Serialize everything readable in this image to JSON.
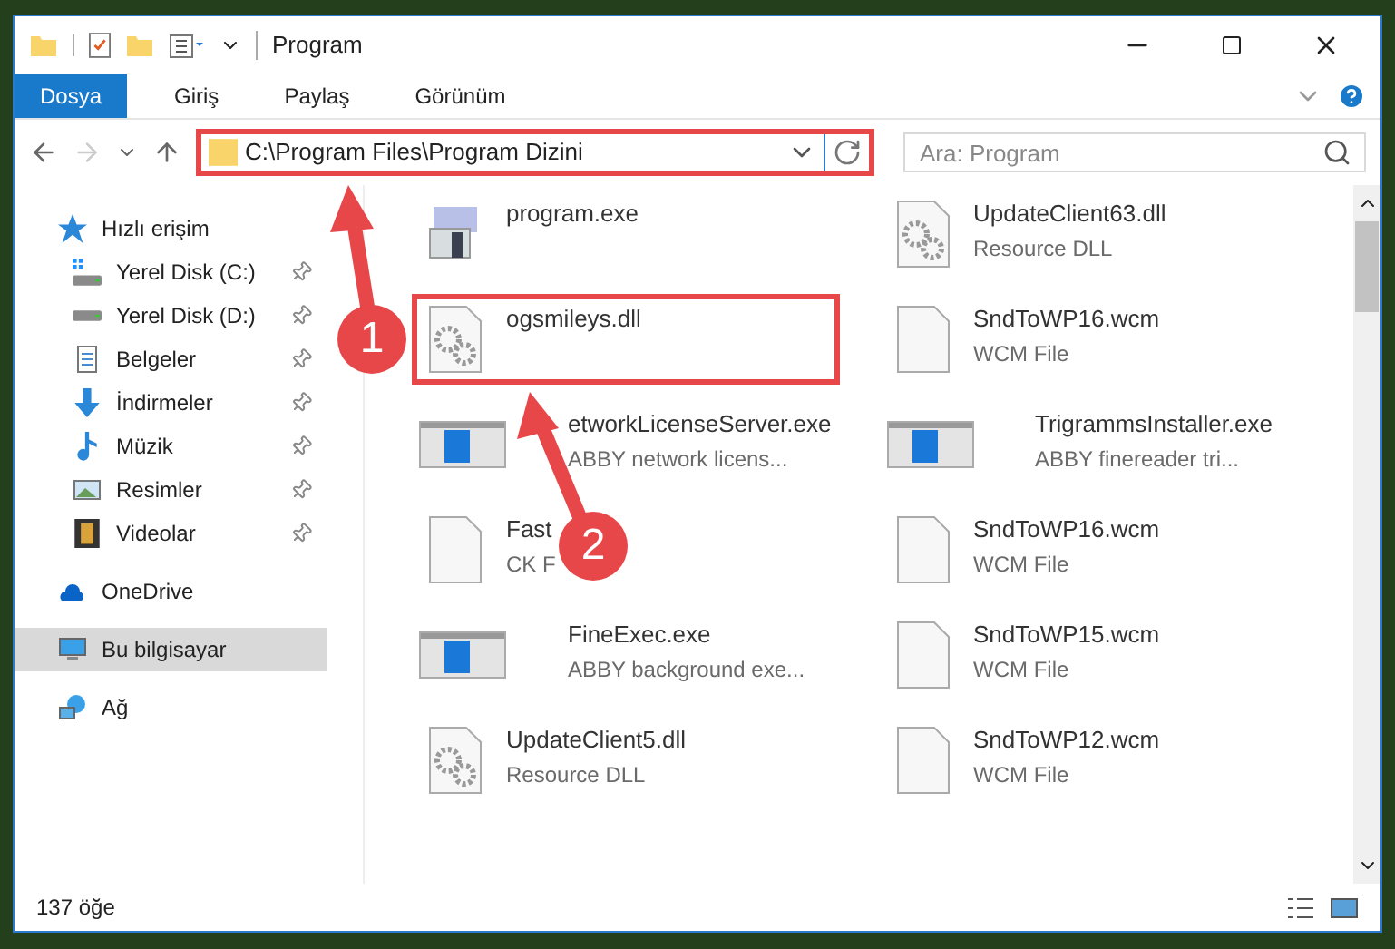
{
  "window": {
    "title": "Program"
  },
  "ribbon_tabs": [
    {
      "label": "Dosya",
      "selected": true
    },
    {
      "label": "Giriş",
      "selected": false
    },
    {
      "label": "Paylaş",
      "selected": false
    },
    {
      "label": "Görünüm",
      "selected": false
    }
  ],
  "address_bar": {
    "value": "C:\\Program Files\\Program Dizini",
    "highlighted": true
  },
  "search": {
    "placeholder": "Ara: Program"
  },
  "sidebar": {
    "items": [
      {
        "label": "Hızlı erişim",
        "kind": "quick",
        "selected": false,
        "children": [
          {
            "label": "Yerel Disk (C:)",
            "kind": "system-drive",
            "pinned": true,
            "selected": false
          },
          {
            "label": "Yerel Disk (D:)",
            "kind": "drive",
            "pinned": true,
            "selected": false
          },
          {
            "label": "Belgeler",
            "kind": "documents",
            "pinned": true,
            "selected": false
          },
          {
            "label": "İndirmeler",
            "kind": "downloads",
            "pinned": true,
            "selected": false
          },
          {
            "label": "Müzik",
            "kind": "music",
            "pinned": true,
            "selected": false
          },
          {
            "label": "Resimler",
            "kind": "pictures",
            "pinned": true,
            "selected": false
          },
          {
            "label": "Videolar",
            "kind": "videos",
            "pinned": true,
            "selected": false
          }
        ]
      },
      {
        "label": "OneDrive",
        "kind": "cloud",
        "selected": false
      },
      {
        "label": "Bu bilgisayar",
        "kind": "computer",
        "selected": true
      },
      {
        "label": "Ağ",
        "kind": "network",
        "selected": false
      }
    ]
  },
  "files": [
    {
      "name": "program.exe",
      "kind": "app",
      "highlighted": false
    },
    {
      "name": "UpdateClient63.dll",
      "type": "Resource DLL",
      "kind": "dll",
      "highlighted": false
    },
    {
      "name": "ogsmileys.dll",
      "kind": "dll",
      "highlighted": true
    },
    {
      "name": "SndToWP16.wcm",
      "type": "WCM File",
      "kind": "file",
      "highlighted": false
    },
    {
      "name": "etworkLicenseServer.exe",
      "type": "ABBY network licens...",
      "kind": "installer",
      "highlighted": false
    },
    {
      "name": "TrigrammsInstaller.exe",
      "type": "ABBY finereader tri...",
      "kind": "installer",
      "highlighted": false
    },
    {
      "name": "Fast",
      "type": "CK F",
      "kind": "file",
      "highlighted": false
    },
    {
      "name": "SndToWP16.wcm",
      "type": "WCM File",
      "kind": "file",
      "highlighted": false
    },
    {
      "name": "FineExec.exe",
      "type": "ABBY background exe...",
      "kind": "installer",
      "highlighted": false
    },
    {
      "name": "SndToWP15.wcm",
      "type": "WCM File",
      "kind": "file",
      "highlighted": false
    },
    {
      "name": "UpdateClient5.dll",
      "type": "Resource DLL",
      "kind": "dll",
      "highlighted": false
    },
    {
      "name": "SndToWP12.wcm",
      "type": "WCM File",
      "kind": "file",
      "highlighted": false
    }
  ],
  "status_bar": {
    "count": "137 öğe"
  },
  "annotations": [
    {
      "number": "1"
    },
    {
      "number": "2"
    }
  ]
}
